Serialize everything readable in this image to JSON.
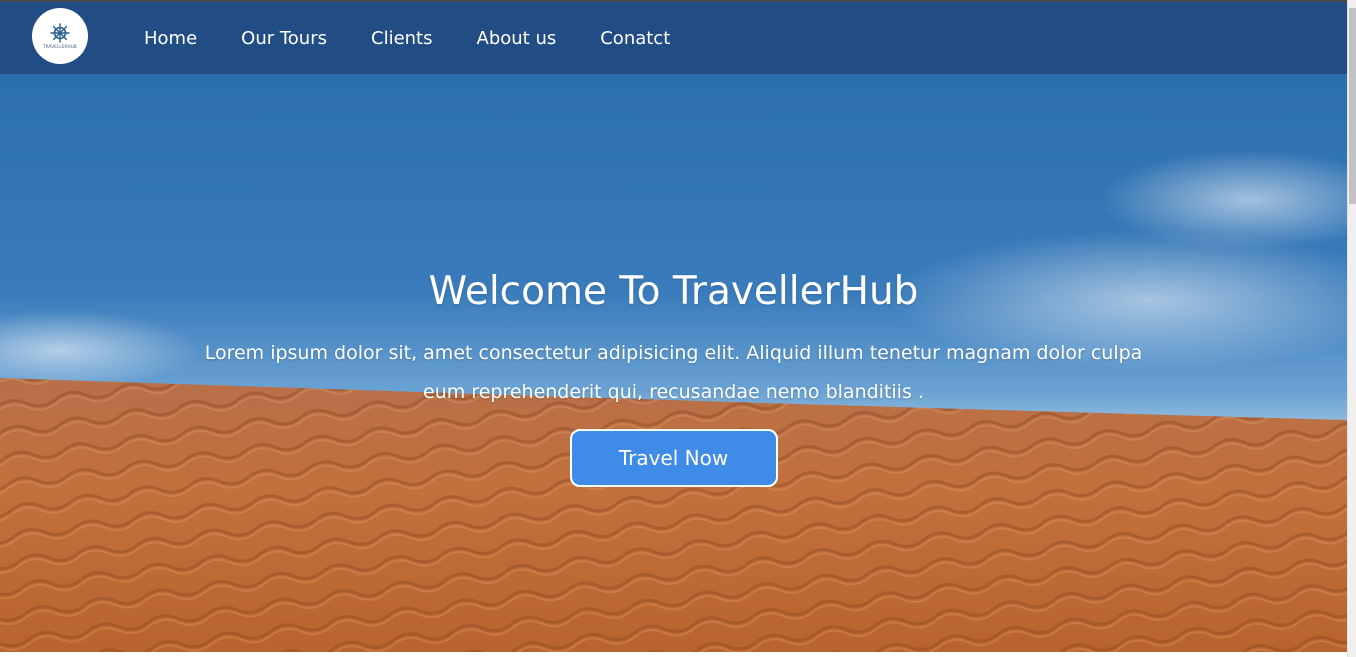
{
  "logo": {
    "icon": "ship-wheel-icon",
    "caption": "TRAVELLERHUB"
  },
  "nav": {
    "items": [
      {
        "label": "Home"
      },
      {
        "label": "Our Tours"
      },
      {
        "label": "Clients"
      },
      {
        "label": "About us"
      },
      {
        "label": "Conatct"
      }
    ]
  },
  "hero": {
    "title": "Welcome To TravellerHub",
    "text": "Lorem ipsum dolor sit, amet consectetur adipisicing elit. Aliquid illum tenetur magnam dolor culpa eum reprehenderit qui, recusandae nemo blanditiis .",
    "button_label": "Travel Now"
  },
  "colors": {
    "navbar": "#214c84",
    "button": "#3e8be8",
    "sky": "#2a6aa8",
    "sand": "#c2703c"
  }
}
